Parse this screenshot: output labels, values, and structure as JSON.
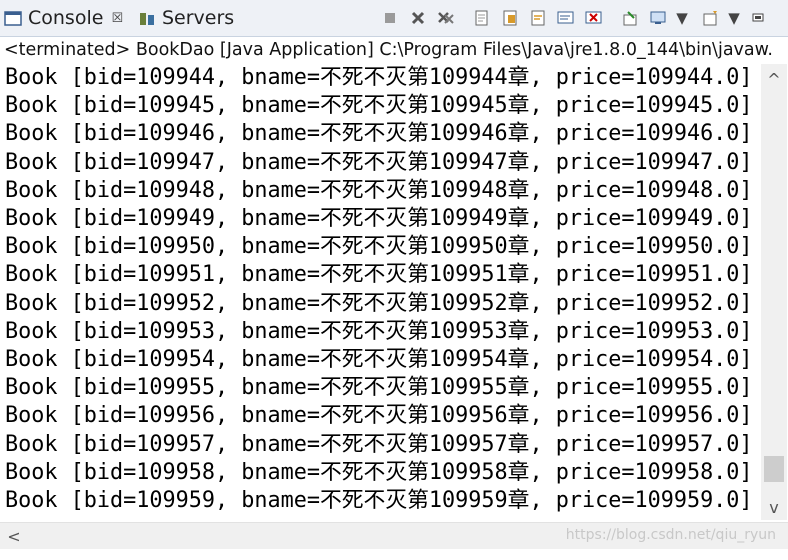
{
  "tabs": {
    "console": "Console",
    "servers": "Servers",
    "close_symbol": "☒"
  },
  "toolbar_icons": [
    "terminate-icon",
    "remove-launch-icon",
    "remove-all-icon",
    "clear-console-icon",
    "scroll-lock-icon",
    "word-wrap-icon",
    "show-stdout-icon",
    "show-stderr-icon",
    "pin-console-icon",
    "display-console-icon",
    "dropdown-icon",
    "open-console-icon",
    "dropdown-icon",
    "minimize-icon"
  ],
  "status": "<terminated> BookDao [Java Application] C:\\Program Files\\Java\\jre1.8.0_144\\bin\\javaw.",
  "lines": [
    "Book [bid=109944, bname=不死不灭第109944章, price=109944.0]",
    "Book [bid=109945, bname=不死不灭第109945章, price=109945.0]",
    "Book [bid=109946, bname=不死不灭第109946章, price=109946.0]",
    "Book [bid=109947, bname=不死不灭第109947章, price=109947.0]",
    "Book [bid=109948, bname=不死不灭第109948章, price=109948.0]",
    "Book [bid=109949, bname=不死不灭第109949章, price=109949.0]",
    "Book [bid=109950, bname=不死不灭第109950章, price=109950.0]",
    "Book [bid=109951, bname=不死不灭第109951章, price=109951.0]",
    "Book [bid=109952, bname=不死不灭第109952章, price=109952.0]",
    "Book [bid=109953, bname=不死不灭第109953章, price=109953.0]",
    "Book [bid=109954, bname=不死不灭第109954章, price=109954.0]",
    "Book [bid=109955, bname=不死不灭第109955章, price=109955.0]",
    "Book [bid=109956, bname=不死不灭第109956章, price=109956.0]",
    "Book [bid=109957, bname=不死不灭第109957章, price=109957.0]",
    "Book [bid=109958, bname=不死不灭第109958章, price=109958.0]",
    "Book [bid=109959, bname=不死不灭第109959章, price=109959.0]"
  ],
  "watermark": "https://blog.csdn.net/qiu_ryun",
  "colors": {
    "tab_bg": "#eef1f6",
    "scroll_bg": "#f0f0f0",
    "thumb": "#cdcdcd"
  }
}
